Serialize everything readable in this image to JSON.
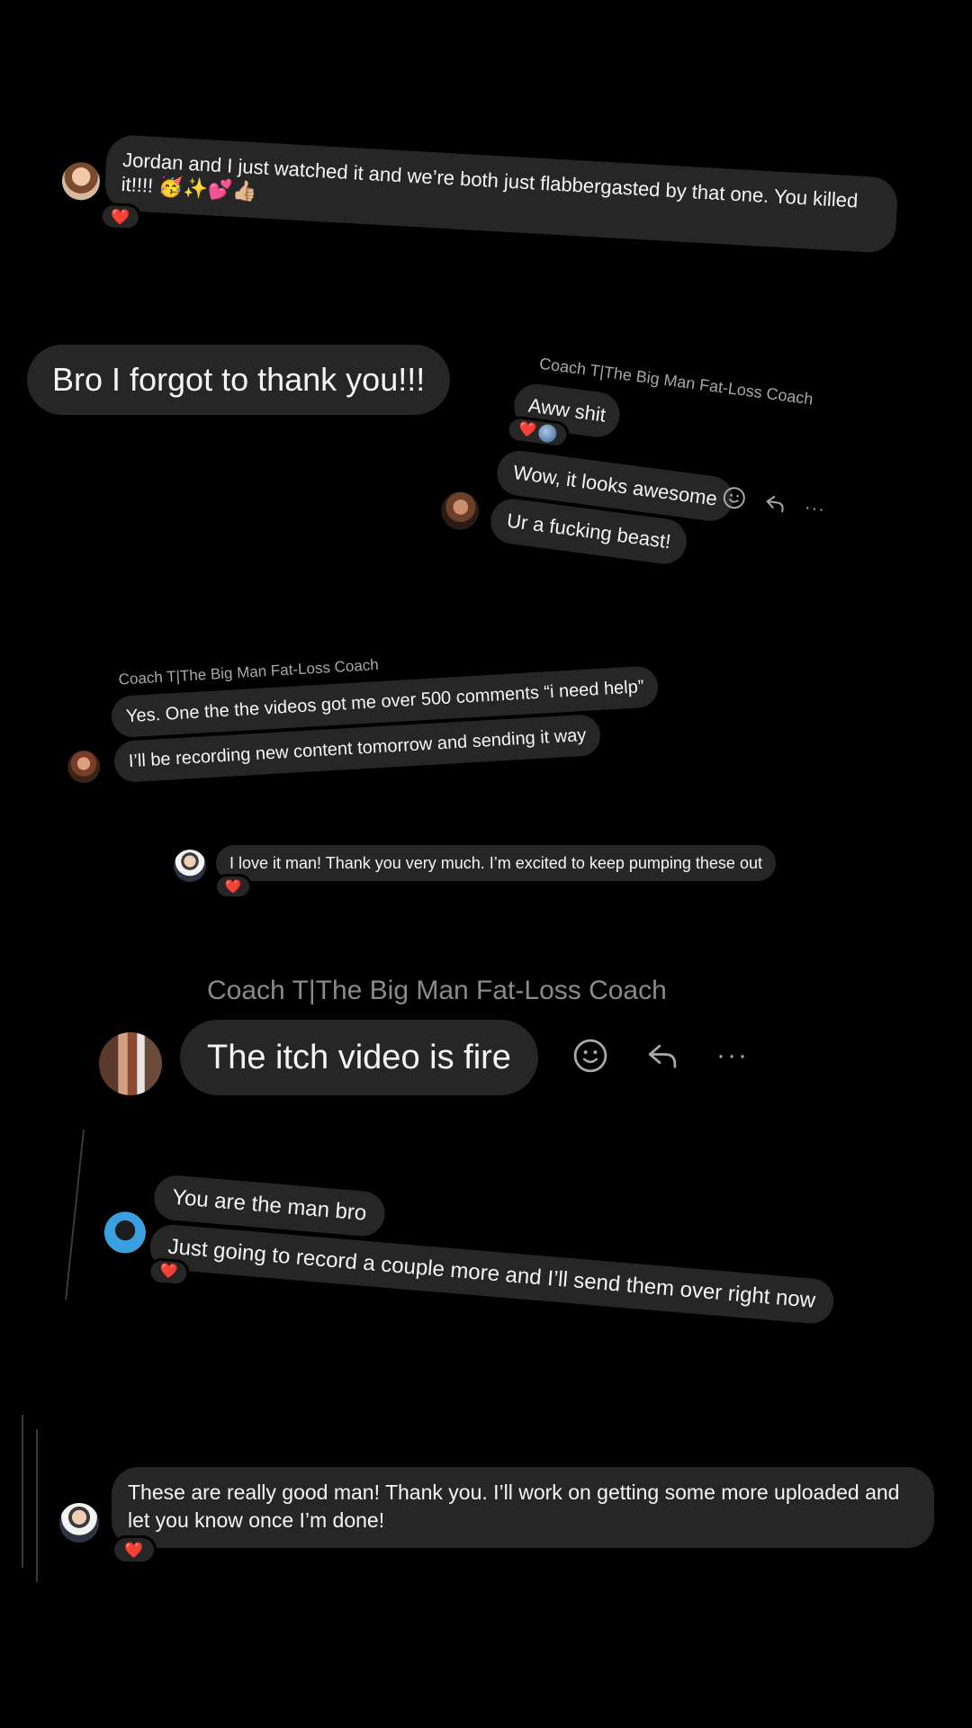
{
  "screenshot_1": {
    "text": "Jordan and I just watched it and we’re both just flabbergasted by that one. You killed it!!!! 🥳✨💕👍🏼",
    "reaction": "❤️"
  },
  "screenshot_2": {
    "sent_message": "Bro I forgot to thank you!!!",
    "sender": "Coach T|The Big Man Fat-Loss Coach",
    "msg1": "Aww shit",
    "msg1_reaction": "❤️",
    "msg2": "Wow, it looks awesome",
    "msg3": "Ur a fucking beast!",
    "more_label": "···"
  },
  "screenshot_3": {
    "sender": "Coach T|The Big Man Fat-Loss Coach",
    "msg1": "Yes. One the the videos got me over 500 comments “i need help”",
    "msg2": "I’ll be recording new content tomorrow and sending it way"
  },
  "screenshot_4": {
    "text": "I love it man! Thank you very much. I’m excited to keep pumping these out",
    "reaction": "❤️"
  },
  "screenshot_5": {
    "sender": "Coach T|The Big Man Fat-Loss Coach",
    "msg": "The itch video is fire",
    "more_label": "···"
  },
  "screenshot_6": {
    "msg1": "You are the man bro",
    "msg2": "Just going to record a couple more and I’ll send them over right now",
    "reaction": "❤️"
  },
  "screenshot_7": {
    "text": "These are really good man! Thank you. I’ll work on getting some more uploaded and let you know once I’m done!",
    "reaction": "❤️"
  },
  "colors": {
    "background": "#000000",
    "bubble": "#262626",
    "sender_text": "#a8a8a8",
    "heart": "#ff2d3c"
  }
}
